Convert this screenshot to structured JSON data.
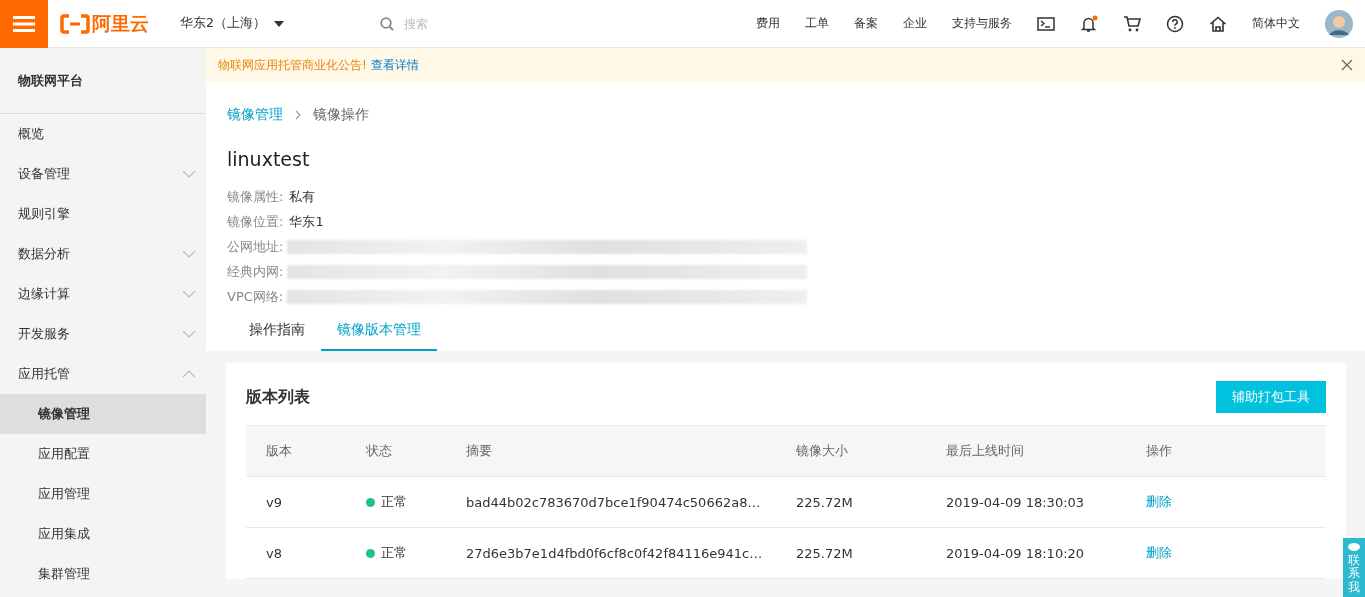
{
  "top_bar": {
    "logo": "阿里云",
    "region": "华东2（上海）",
    "search": {
      "placeholder": "搜索"
    },
    "nav_links": [
      "费用",
      "工单",
      "备案",
      "企业",
      "支持与服务"
    ],
    "bell_badge": true,
    "language": "简体中文"
  },
  "notice": {
    "text": "物联网应用托管商业化公告!",
    "link": "查看详情"
  },
  "sidebar": {
    "title": "物联网平台",
    "items": [
      {
        "label": "概览",
        "selected": false
      },
      {
        "label": "设备管理",
        "selected": false,
        "expanded": false
      },
      {
        "label": "规则引擎",
        "selected": false
      },
      {
        "label": "数据分析",
        "selected": false,
        "expanded": false
      },
      {
        "label": "边缘计算",
        "selected": false,
        "expanded": false
      },
      {
        "label": "开发服务",
        "selected": false,
        "expanded": false
      },
      {
        "label": "应用托管",
        "selected": false,
        "expanded": true,
        "children": [
          {
            "label": "镜像管理",
            "selected": true
          },
          {
            "label": "应用配置",
            "selected": false
          },
          {
            "label": "应用管理",
            "selected": false
          },
          {
            "label": "应用集成",
            "selected": false
          },
          {
            "label": "集群管理",
            "selected": false
          }
        ]
      }
    ]
  },
  "breadcrumb": [
    "镜像管理",
    "镜像操作"
  ],
  "title": "linuxtest",
  "properties": [
    {
      "label": "镜像属性:",
      "value": "私有",
      "redacted": false
    },
    {
      "label": "镜像位置:",
      "value": "华东1",
      "redacted": false
    },
    {
      "label": "公网地址:",
      "redacted": true
    },
    {
      "label": "经典内网:",
      "redacted": true
    },
    {
      "label": "VPC网络:",
      "redacted": true
    }
  ],
  "tabs": [
    {
      "label": "操作指南",
      "selected": false
    },
    {
      "label": "镜像版本管理",
      "selected": true
    }
  ],
  "card": {
    "title": "版本列表",
    "button": "辅助打包工具",
    "table": {
      "columns": [
        "版本",
        "状态",
        "摘要",
        "镜像大小",
        "最后上线时间",
        "操作"
      ],
      "rows": [
        {
          "version": "v9",
          "status": "正常",
          "color": "#1ec38b",
          "digest": "bad44b02c783670d7bce1f90474c50662a8…",
          "size": "225.72M",
          "time": "2019-04-09 18:30:03",
          "action": "删除"
        },
        {
          "version": "v8",
          "status": "正常",
          "color": "#1ec38b",
          "digest": "27d6e3b7e1d4fbd0f6cf8c0f42f84116e941c…",
          "size": "225.72M",
          "time": "2019-04-09 18:10:20",
          "action": "删除"
        }
      ]
    }
  },
  "contact": "联系我"
}
